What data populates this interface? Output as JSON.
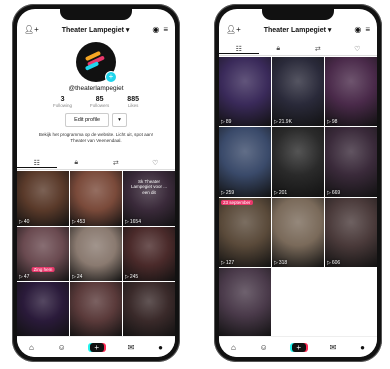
{
  "left_phone": {
    "title": "Theater Lampegiet",
    "handle": "@theaterlampegiet",
    "stats": [
      {
        "value": "3",
        "label": "Following"
      },
      {
        "value": "85",
        "label": "Followers"
      },
      {
        "value": "885",
        "label": "Likes"
      }
    ],
    "edit_profile": "Edit profile",
    "bio": "Bekijk het programma op de website. Licht uit, spot aan! Theater van Veenendaal.",
    "grid": [
      {
        "views": "40",
        "color": "#5a3a2a"
      },
      {
        "views": "453",
        "color": "#7a4a3a"
      },
      {
        "views": "1654",
        "color": "#3a2a3a",
        "text": "Sk Theater Lampegiet voor ... een dit"
      },
      {
        "views": "47",
        "color": "#6a4a50",
        "caption": "Zing hem"
      },
      {
        "views": "24",
        "color": "#8a7a70"
      },
      {
        "views": "245",
        "color": "#4a2a2a"
      },
      {
        "views": "",
        "color": "#2a1a3a"
      },
      {
        "views": "",
        "color": "#5a3a3a"
      },
      {
        "views": "",
        "color": "#3a2a2a"
      }
    ]
  },
  "right_phone": {
    "title": "Theater Lampegiet",
    "grid": [
      {
        "views": "89",
        "color": "#3a2a5a"
      },
      {
        "views": "21.9K",
        "color": "#2a2a3a"
      },
      {
        "views": "98",
        "color": "#4a2a4a"
      },
      {
        "views": "259",
        "color": "#3a4a6a"
      },
      {
        "views": "201",
        "color": "#2a2a2a"
      },
      {
        "views": "669",
        "color": "#3a2a3a"
      },
      {
        "views": "127",
        "color": "#5a4a3a",
        "pin": "23 september"
      },
      {
        "views": "318",
        "color": "#7a6a5a"
      },
      {
        "views": "606",
        "color": "#4a3a3a"
      },
      {
        "views": "",
        "color": "#4a3a4a"
      }
    ]
  },
  "bottom_bar": {
    "home": "Home",
    "friends": "Friends",
    "inbox": "Inbox",
    "profile": "Profile"
  },
  "colors": {
    "accent": "#fe2c55",
    "cyan": "#25f4ee",
    "pink": "#e8386b"
  }
}
